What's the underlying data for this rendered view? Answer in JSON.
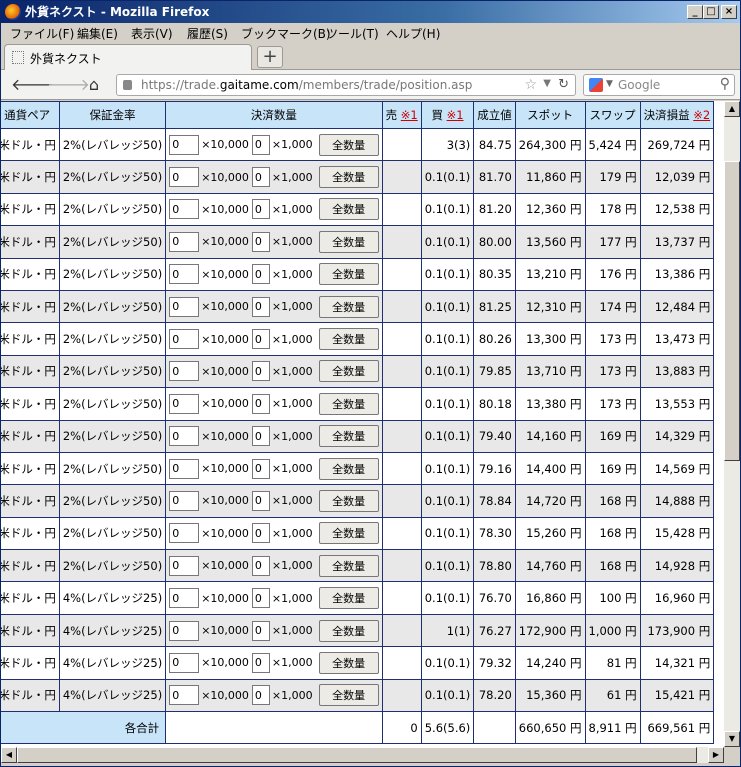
{
  "window": {
    "title": "外貨ネクスト - Mozilla Firefox"
  },
  "menu": [
    "ファイル(F)",
    "編集(E)",
    "表示(V)",
    "履歴(S)",
    "ブックマーク(B)",
    "ツール(T)",
    "ヘルプ(H)"
  ],
  "tab": {
    "label": "外貨ネクスト",
    "new_tab": "+"
  },
  "nav": {
    "url_prefix": "https://trade.",
    "url_domain": "gaitame.com",
    "url_path": "/members/trade/position.asp",
    "search_placeholder": "Google"
  },
  "table": {
    "headers": {
      "pair": "通貨ペア",
      "margin": "保証金率",
      "qty": "決済数量",
      "sell": "売",
      "buy": "買",
      "note1": "※1",
      "price": "成立値",
      "spot": "スポット",
      "swap": "スワップ",
      "pl": "決済損益",
      "note2": "※2"
    },
    "unit_10000": "×10,000",
    "unit_1000": "×1,000",
    "all_button": "全数量",
    "default_qty": "0",
    "rows": [
      {
        "id": "5",
        "pair": "米ドル・円",
        "margin": "2%(レバレッジ50)",
        "sell": "",
        "buy": "3(3)",
        "price": "84.75",
        "spot": "264,300 円",
        "swap": "5,424 円",
        "pl": "269,724 円"
      },
      {
        "id": "0",
        "pair": "米ドル・円",
        "margin": "2%(レバレッジ50)",
        "sell": "",
        "buy": "0.1(0.1)",
        "price": "81.70",
        "spot": "11,860 円",
        "swap": "179 円",
        "pl": "12,039 円"
      },
      {
        "id": "3",
        "pair": "米ドル・円",
        "margin": "2%(レバレッジ50)",
        "sell": "",
        "buy": "0.1(0.1)",
        "price": "81.20",
        "spot": "12,360 円",
        "swap": "178 円",
        "pl": "12,538 円"
      },
      {
        "id": "4",
        "pair": "米ドル・円",
        "margin": "2%(レバレッジ50)",
        "sell": "",
        "buy": "0.1(0.1)",
        "price": "80.00",
        "spot": "13,560 円",
        "swap": "177 円",
        "pl": "13,737 円"
      },
      {
        "id": "7",
        "pair": "米ドル・円",
        "margin": "2%(レバレッジ50)",
        "sell": "",
        "buy": "0.1(0.1)",
        "price": "80.35",
        "spot": "13,210 円",
        "swap": "176 円",
        "pl": "13,386 円"
      },
      {
        "id": "9",
        "pair": "米ドル・円",
        "margin": "2%(レバレッジ50)",
        "sell": "",
        "buy": "0.1(0.1)",
        "price": "81.25",
        "spot": "12,310 円",
        "swap": "174 円",
        "pl": "12,484 円"
      },
      {
        "id": "4",
        "pair": "米ドル・円",
        "margin": "2%(レバレッジ50)",
        "sell": "",
        "buy": "0.1(0.1)",
        "price": "80.26",
        "spot": "13,300 円",
        "swap": "173 円",
        "pl": "13,473 円"
      },
      {
        "id": "5",
        "pair": "米ドル・円",
        "margin": "2%(レバレッジ50)",
        "sell": "",
        "buy": "0.1(0.1)",
        "price": "79.85",
        "spot": "13,710 円",
        "swap": "173 円",
        "pl": "13,883 円"
      },
      {
        "id": "6",
        "pair": "米ドル・円",
        "margin": "2%(レバレッジ50)",
        "sell": "",
        "buy": "0.1(0.1)",
        "price": "80.18",
        "spot": "13,380 円",
        "swap": "173 円",
        "pl": "13,553 円"
      },
      {
        "id": "0",
        "pair": "米ドル・円",
        "margin": "2%(レバレッジ50)",
        "sell": "",
        "buy": "0.1(0.1)",
        "price": "79.40",
        "spot": "14,160 円",
        "swap": "169 円",
        "pl": "14,329 円"
      },
      {
        "id": "3",
        "pair": "米ドル・円",
        "margin": "2%(レバレッジ50)",
        "sell": "",
        "buy": "0.1(0.1)",
        "price": "79.16",
        "spot": "14,400 円",
        "swap": "169 円",
        "pl": "14,569 円"
      },
      {
        "id": "6",
        "pair": "米ドル・円",
        "margin": "2%(レバレッジ50)",
        "sell": "",
        "buy": "0.1(0.1)",
        "price": "78.84",
        "spot": "14,720 円",
        "swap": "168 円",
        "pl": "14,888 円"
      },
      {
        "id": "0",
        "pair": "米ドル・円",
        "margin": "2%(レバレッジ50)",
        "sell": "",
        "buy": "0.1(0.1)",
        "price": "78.30",
        "spot": "15,260 円",
        "swap": "168 円",
        "pl": "15,428 円"
      },
      {
        "id": "2",
        "pair": "米ドル・円",
        "margin": "2%(レバレッジ50)",
        "sell": "",
        "buy": "0.1(0.1)",
        "price": "78.80",
        "spot": "14,760 円",
        "swap": "168 円",
        "pl": "14,928 円"
      },
      {
        "id": "1",
        "pair": "米ドル・円",
        "margin": "4%(レバレッジ25)",
        "sell": "",
        "buy": "0.1(0.1)",
        "price": "76.70",
        "spot": "16,860 円",
        "swap": "100 円",
        "pl": "16,960 円"
      },
      {
        "id": "3",
        "pair": "米ドル・円",
        "margin": "4%(レバレッジ25)",
        "sell": "",
        "buy": "1(1)",
        "price": "76.27",
        "spot": "172,900 円",
        "swap": "1,000 円",
        "pl": "173,900 円"
      },
      {
        "id": "7",
        "pair": "米ドル・円",
        "margin": "4%(レバレッジ25)",
        "sell": "",
        "buy": "0.1(0.1)",
        "price": "79.32",
        "spot": "14,240 円",
        "swap": "81 円",
        "pl": "14,321 円"
      },
      {
        "id": "1",
        "pair": "米ドル・円",
        "margin": "4%(レバレッジ25)",
        "sell": "",
        "buy": "0.1(0.1)",
        "price": "78.20",
        "spot": "15,360 円",
        "swap": "61 円",
        "pl": "15,421 円"
      }
    ],
    "total": {
      "label": "各合計",
      "sell": "0",
      "buy": "5.6(5.6)",
      "spot": "660,650 円",
      "swap": "8,911 円",
      "pl": "669,561 円"
    }
  }
}
